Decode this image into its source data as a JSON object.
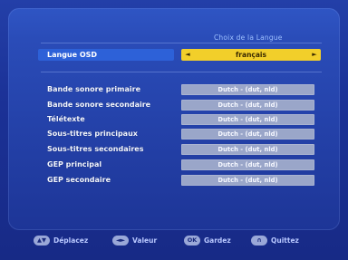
{
  "header": {
    "title": "Choix de la Langue"
  },
  "osd": {
    "label": "Langue OSD",
    "value": "français",
    "left_arrow": "◄",
    "right_arrow": "►"
  },
  "rows": [
    {
      "label": "Bande sonore primaire",
      "value": "Dutch - (dut, nld)"
    },
    {
      "label": "Bande sonore secondaire",
      "value": "Dutch - (dut, nld)"
    },
    {
      "label": "Télétexte",
      "value": "Dutch - (dut, nld)"
    },
    {
      "label": "Sous-titres principaux",
      "value": "Dutch - (dut, nld)"
    },
    {
      "label": "Sous-titres secondaires",
      "value": "Dutch - (dut, nld)"
    },
    {
      "label": "GEP principal",
      "value": "Dutch - (dut, nld)"
    },
    {
      "label": "GEP secondaire",
      "value": "Dutch - (dut, nld)"
    }
  ],
  "footer": {
    "move": {
      "key": "▲▼",
      "label": "Déplacez"
    },
    "value": {
      "key": "◄►",
      "label": "Valeur"
    },
    "save": {
      "key": "OK",
      "label": "Gardez"
    },
    "exit": {
      "key": "∩",
      "label": "Quittez"
    }
  },
  "colors": {
    "background": "#1b2f8e",
    "highlight": "#2d61d8",
    "selection": "#f2cf2a",
    "field": "#9aa6c9"
  }
}
